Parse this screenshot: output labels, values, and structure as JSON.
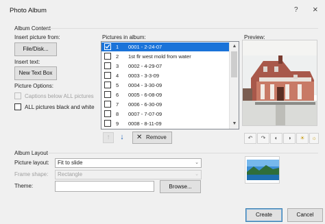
{
  "title": "Photo Album",
  "window": {
    "help": "?",
    "close": "×"
  },
  "album_content": {
    "group_label": "Album Content",
    "insert_picture_from": "Insert picture from:",
    "file_disk": "File/Disk...",
    "insert_text": "Insert text:",
    "new_text_box": "New Text Box",
    "picture_options": "Picture Options:",
    "captions": "Captions below ALL pictures",
    "black_white": "ALL pictures black and white"
  },
  "pictures": {
    "label": "Pictures in album:",
    "items": [
      {
        "num": "1",
        "name": "0001 - 2-24-07",
        "checked": true,
        "selected": true
      },
      {
        "num": "2",
        "name": "1st flr west mold from water",
        "checked": false,
        "selected": false
      },
      {
        "num": "3",
        "name": "0002 - 4-29-07",
        "checked": false,
        "selected": false
      },
      {
        "num": "4",
        "name": "0003 - 3-3-09",
        "checked": false,
        "selected": false
      },
      {
        "num": "5",
        "name": "0004 - 3-30-09",
        "checked": false,
        "selected": false
      },
      {
        "num": "6",
        "name": "0005 - 6-08-09",
        "checked": false,
        "selected": false
      },
      {
        "num": "7",
        "name": "0006 - 6-30-09",
        "checked": false,
        "selected": false
      },
      {
        "num": "8",
        "name": "0007 - 7-07-09",
        "checked": false,
        "selected": false
      },
      {
        "num": "9",
        "name": "0008 - 8-11-09",
        "checked": false,
        "selected": false
      }
    ],
    "up": "↑",
    "down": "↓",
    "remove": "Remove",
    "remove_icon": "✕"
  },
  "preview": {
    "label": "Preview:",
    "tools": [
      "↶",
      "↷",
      "◐",
      "◑",
      "☀",
      "☼"
    ]
  },
  "album_layout": {
    "group_label": "Album Layout",
    "picture_layout_label": "Picture layout:",
    "picture_layout_value": "Fit to slide",
    "frame_shape_label": "Frame shape:",
    "frame_shape_value": "Rectangle",
    "theme_label": "Theme:",
    "theme_value": "",
    "browse": "Browse..."
  },
  "actions": {
    "create": "Create",
    "cancel": "Cancel"
  }
}
